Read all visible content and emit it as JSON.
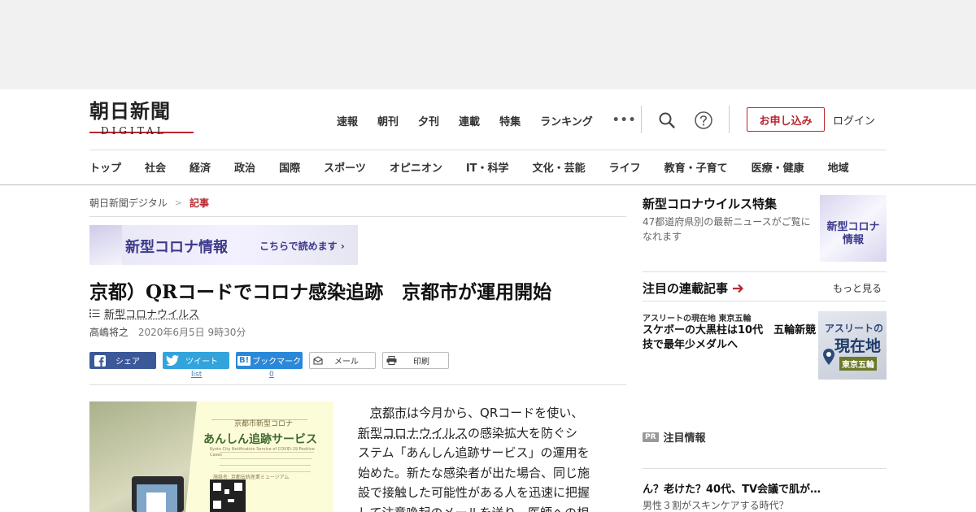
{
  "header": {
    "logo": {
      "main": "朝日新聞",
      "sub": "DIGITAL"
    },
    "top_nav": [
      "速報",
      "朝刊",
      "夕刊",
      "連載",
      "特集",
      "ランキング"
    ],
    "more": "•••",
    "apply_label": "お申し込み",
    "login_label": "ログイン",
    "categories": [
      "トップ",
      "社会",
      "経済",
      "政治",
      "国際",
      "スポーツ",
      "オピニオン",
      "IT・科学",
      "文化・芸能",
      "ライフ",
      "教育・子育て",
      "医療・健康",
      "地域"
    ],
    "accent": "#b9282f"
  },
  "breadcrumb": {
    "home": "朝日新聞デジタル",
    "sep": ">",
    "current": "記事"
  },
  "banner": {
    "title": "新型コロナ情報",
    "sub": "こちらで読めます ›"
  },
  "article": {
    "headline": "京都）QRコードでコロナ感染追跡　京都市が運用開始",
    "tag": "新型コロナウイルス",
    "author": "高嶋将之",
    "date": "2020年6月5日 9時30分",
    "share": {
      "facebook": "シェア",
      "twitter": "ツイート",
      "twitter_count": "list",
      "hatena_mark": "B!",
      "hatena": "ブックマーク",
      "hatena_count": "0",
      "mail": "メール",
      "print": "印刷"
    },
    "photo": {
      "poster_header": "京都市新型コロナ",
      "poster_title": "あんしん追跡サービス",
      "poster_en": "Kyoto City Notification Service of COVID-19 Positive Cases",
      "poster_facility": "施設名: 京都伝統産業ミュージアム"
    },
    "body": {
      "l1_a": "京都市",
      "l1_b": "は今月から、QRコードを使い、",
      "l2_a": "新型コロナウイルス",
      "l2_b": "の感染拡大を防ぐシ",
      "l3": "ステム「あんしん追跡サービス」の運用を",
      "l4": "始めた。新たな感染者が出た場合、同じ施",
      "l5": "設で接触した可能性がある人を迅速に把握",
      "l6": "して注意喚起のメールを送り、医師への相"
    }
  },
  "sidebar": {
    "feature_title": "新型コロナウイルス特集",
    "feature_desc": "47都道府県別の最新ニュースがご覧になれます",
    "feature_thumb": [
      "新型コロナ",
      "情報"
    ],
    "series_heading": "注目の連載記事",
    "more": "もっと見る",
    "series_kicker": "アスリートの現在地 東京五輪",
    "series_title": "スケボーの大黒柱は10代　五輪新競技で最年少メダルへ",
    "series_thumb": [
      "アスリートの",
      "現在地",
      "東京五輪"
    ],
    "pr_badge": "PR",
    "pr_label": "注目情報",
    "ad_title": "ん？老けた？40代、TV会議で肌が…",
    "ad_sub": "男性３割がスキンケアする時代？"
  }
}
